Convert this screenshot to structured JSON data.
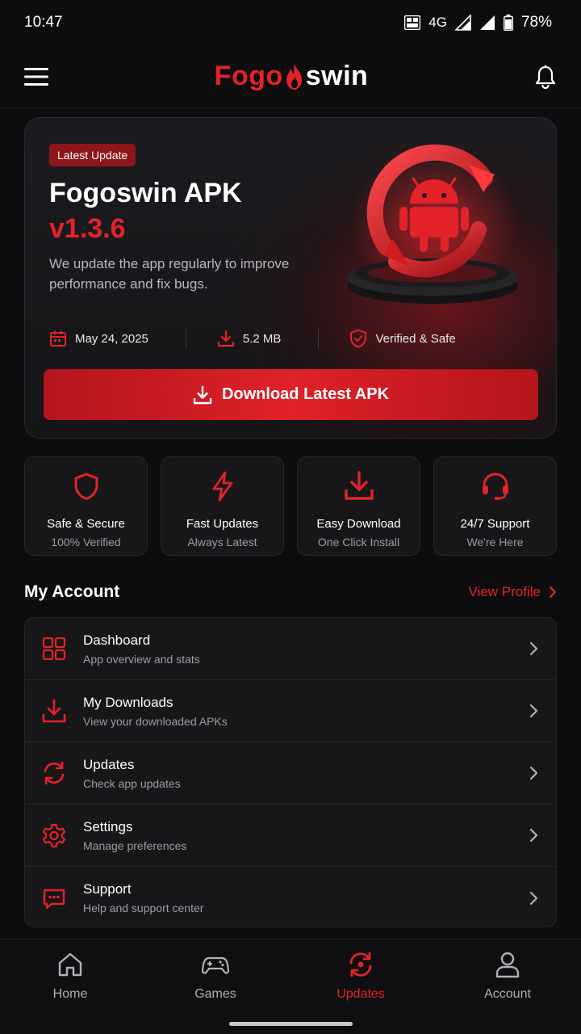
{
  "status": {
    "time": "10:47",
    "network": "4G",
    "battery": "78%"
  },
  "header": {
    "logo_left": "Fogo",
    "logo_right": "swin"
  },
  "hero": {
    "badge": "Latest Update",
    "title": "Fogoswin APK",
    "version": "v1.3.6",
    "description": "We update the app regularly to improve performance and fix bugs.",
    "date": "May 24, 2025",
    "size": "5.2 MB",
    "verified": "Verified & Safe",
    "button_label": "Download Latest APK"
  },
  "features": [
    {
      "title": "Safe & Secure",
      "subtitle": "100% Verified",
      "icon": "shield-icon"
    },
    {
      "title": "Fast Updates",
      "subtitle": "Always Latest",
      "icon": "lightning-icon"
    },
    {
      "title": "Easy Download",
      "subtitle": "One Click Install",
      "icon": "download-icon"
    },
    {
      "title": "24/7 Support",
      "subtitle": "We're Here",
      "icon": "headset-icon"
    }
  ],
  "account": {
    "section_title": "My Account",
    "view_profile": "View Profile",
    "items": [
      {
        "title": "Dashboard",
        "subtitle": "App overview and stats",
        "icon": "grid-icon"
      },
      {
        "title": "My Downloads",
        "subtitle": "View your downloaded APKs",
        "icon": "download-icon"
      },
      {
        "title": "Updates",
        "subtitle": "Check app updates",
        "icon": "refresh-icon"
      },
      {
        "title": "Settings",
        "subtitle": "Manage preferences",
        "icon": "gear-icon"
      },
      {
        "title": "Support",
        "subtitle": "Help and support center",
        "icon": "chat-icon"
      }
    ]
  },
  "nav": {
    "items": [
      {
        "label": "Home",
        "icon": "home-icon"
      },
      {
        "label": "Games",
        "icon": "gamepad-icon"
      },
      {
        "label": "Updates",
        "icon": "refresh-icon",
        "active": true
      },
      {
        "label": "Account",
        "icon": "user-icon"
      }
    ]
  },
  "colors": {
    "accent": "#e3222a",
    "background": "#0d0d0f",
    "card": "#17171a"
  }
}
